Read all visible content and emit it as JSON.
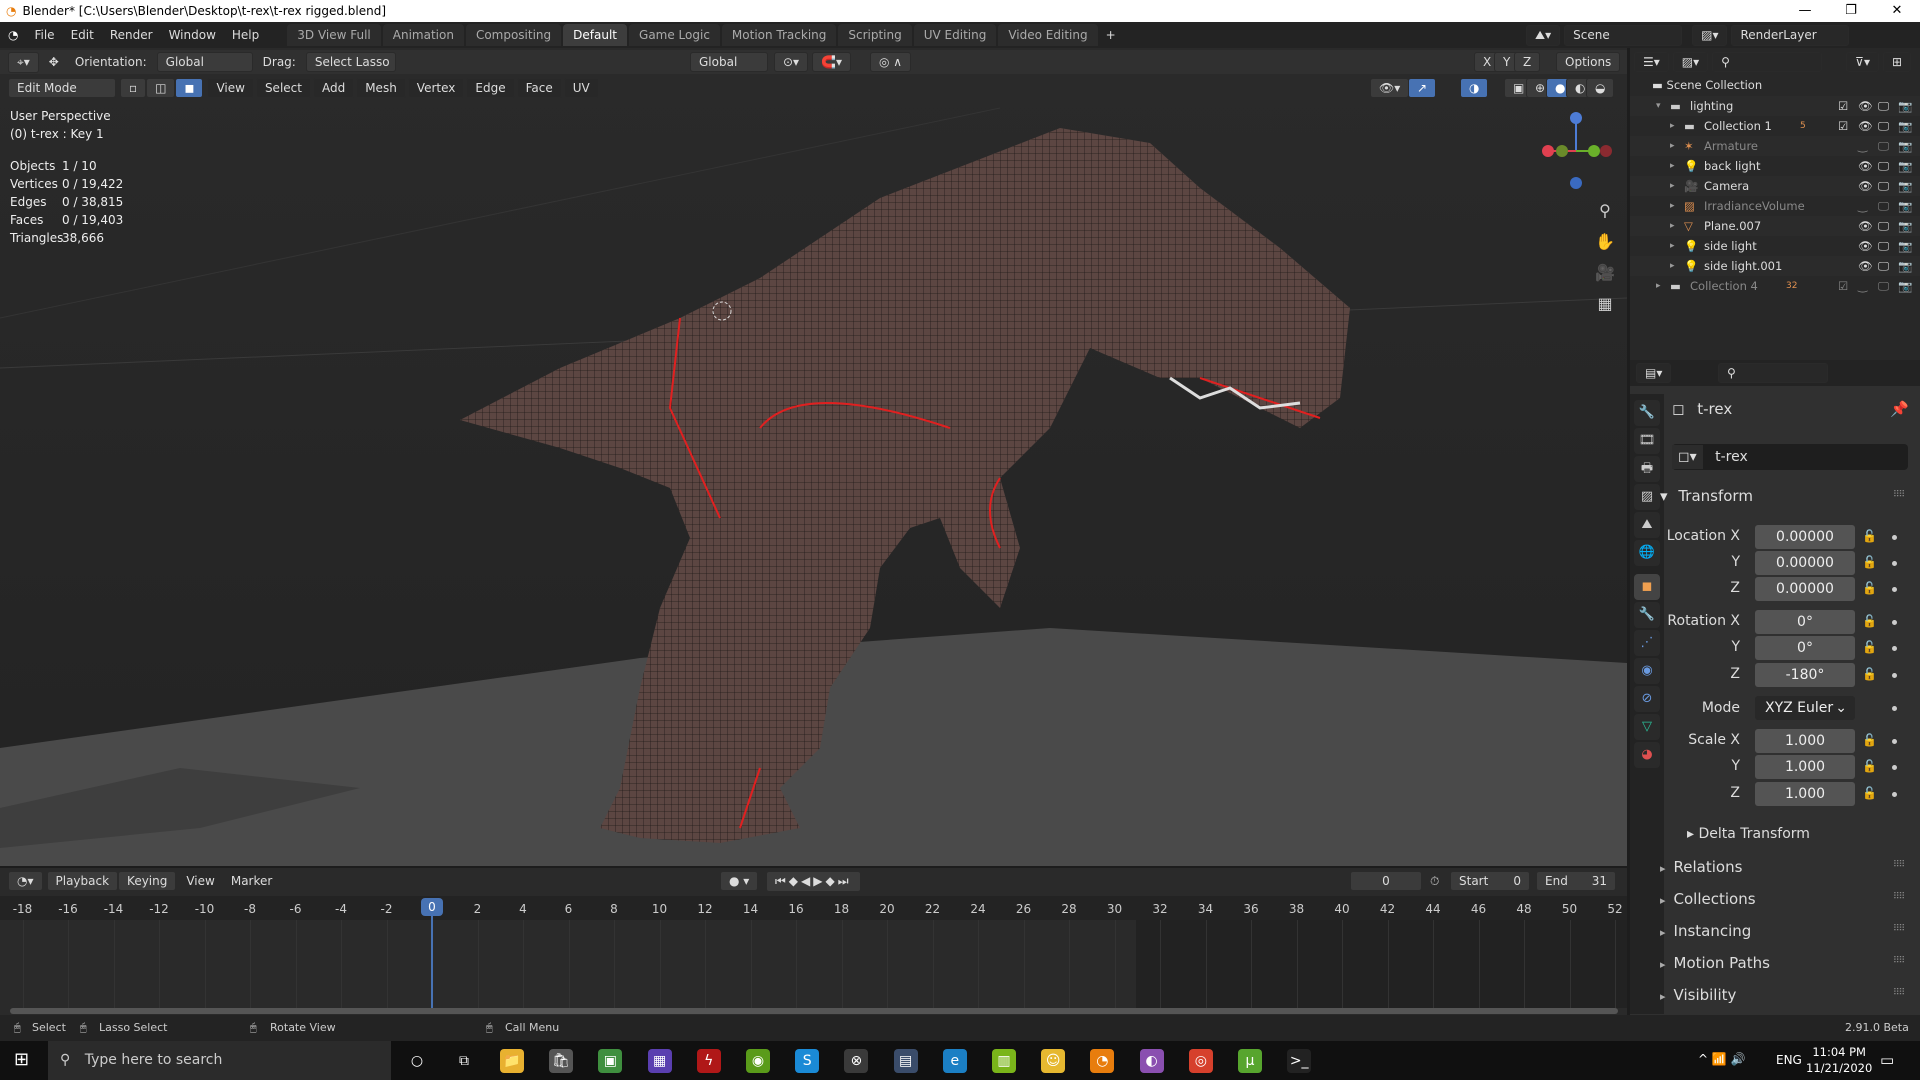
{
  "window": {
    "title": "Blender* [C:\\Users\\Blender\\Desktop\\t-rex\\t-rex rigged.blend]",
    "minimize": "—",
    "maximize": "❐",
    "close": "✕"
  },
  "menu": [
    "File",
    "Edit",
    "Render",
    "Window",
    "Help"
  ],
  "workspaces": [
    {
      "label": "3D View Full",
      "active": false
    },
    {
      "label": "Animation",
      "active": false
    },
    {
      "label": "Compositing",
      "active": false
    },
    {
      "label": "Default",
      "active": true
    },
    {
      "label": "Game Logic",
      "active": false
    },
    {
      "label": "Motion Tracking",
      "active": false
    },
    {
      "label": "Scripting",
      "active": false
    },
    {
      "label": "UV Editing",
      "active": false
    },
    {
      "label": "Video Editing",
      "active": false
    }
  ],
  "add_workspace": "+",
  "scene": {
    "name": "Scene",
    "view_layer": "RenderLayer"
  },
  "tool_header": {
    "orientation_label": "Orientation:",
    "orientation_value": "Global",
    "drag_label": "Drag:",
    "drag_value": "Select Lasso",
    "transform_orientation": "Global",
    "axis": [
      "X",
      "Y",
      "Z"
    ],
    "options": "Options"
  },
  "view_header": {
    "mode": "Edit Mode",
    "menus": [
      "View",
      "Select",
      "Add",
      "Mesh",
      "Vertex",
      "Edge",
      "Face",
      "UV"
    ]
  },
  "overlay_info": {
    "view": "User Perspective",
    "object": "(0) t-rex : Key 1",
    "stats": [
      {
        "label": "Objects",
        "value": "1 / 10"
      },
      {
        "label": "Vertices",
        "value": "0 / 19,422"
      },
      {
        "label": "Edges",
        "value": "0 / 38,815"
      },
      {
        "label": "Faces",
        "value": "0 / 19,403"
      },
      {
        "label": "Triangles",
        "value": "38,666"
      }
    ]
  },
  "outliner": {
    "root": "Scene Collection",
    "items": [
      {
        "label": "lighting",
        "depth": 0,
        "icon": "collection-icon",
        "color": "#ddd"
      },
      {
        "label": "Collection 1",
        "depth": 1,
        "icon": "collection-icon",
        "badge": "5",
        "color": "#ddd"
      },
      {
        "label": "Armature",
        "depth": 1,
        "icon": "armature-icon",
        "color": "#888"
      },
      {
        "label": "back light",
        "depth": 1,
        "icon": "light-icon",
        "color": "#ddd"
      },
      {
        "label": "Camera",
        "depth": 1,
        "icon": "camera-icon",
        "color": "#ddd"
      },
      {
        "label": "IrradianceVolume",
        "depth": 1,
        "icon": "lightprobe-icon",
        "color": "#888"
      },
      {
        "label": "Plane.007",
        "depth": 1,
        "icon": "mesh-icon",
        "color": "#ddd"
      },
      {
        "label": "side light",
        "depth": 1,
        "icon": "light-icon",
        "color": "#ddd"
      },
      {
        "label": "side light.001",
        "depth": 1,
        "icon": "light-icon",
        "color": "#ddd"
      },
      {
        "label": "Collection 4",
        "depth": 0,
        "icon": "collection-icon",
        "badge": "32",
        "color": "#888"
      }
    ]
  },
  "properties": {
    "object_name": "t-rex",
    "datablock": "t-rex",
    "transform_title": "Transform",
    "location": {
      "label": "Location X",
      "x": "0.00000",
      "y": "0.00000",
      "z": "0.00000"
    },
    "rotation": {
      "label": "Rotation X",
      "x": "0°",
      "y": "0°",
      "z": "-180°"
    },
    "mode": {
      "label": "Mode",
      "value": "XYZ Euler"
    },
    "scale": {
      "label": "Scale X",
      "x": "1.000",
      "y": "1.000",
      "z": "1.000"
    },
    "axis_labels": {
      "y": "Y",
      "z": "Z"
    },
    "subpanel": "Delta Transform",
    "sections": [
      "Relations",
      "Collections",
      "Instancing",
      "Motion Paths",
      "Visibility"
    ]
  },
  "timeline": {
    "menus": [
      "Playback",
      "Keying",
      "View",
      "Marker"
    ],
    "current_frame": "0",
    "start_label": "Start",
    "start": "0",
    "end_label": "End",
    "end": "31",
    "ticks": [
      -18,
      -16,
      -14,
      -12,
      -10,
      -8,
      -6,
      -4,
      -2,
      0,
      2,
      4,
      6,
      8,
      10,
      12,
      14,
      16,
      18,
      20,
      22,
      24,
      26,
      28,
      30,
      32,
      34,
      36,
      38,
      40,
      42,
      44,
      46,
      48,
      50,
      52
    ],
    "playhead": "0"
  },
  "statusbar": {
    "hints": [
      "Select",
      "Lasso Select",
      "Rotate View",
      "Call Menu"
    ],
    "version": "2.91.0 Beta"
  },
  "taskbar": {
    "search_placeholder": "Type here to search",
    "time": "11:04 PM",
    "date": "11/21/2020",
    "lang": "ENG",
    "apps": [
      {
        "name": "cortana",
        "glyph": "○",
        "color": "transparent"
      },
      {
        "name": "task-view",
        "glyph": "⧉",
        "color": "transparent"
      },
      {
        "name": "file-explorer",
        "glyph": "📁",
        "color": "#e8b130"
      },
      {
        "name": "store",
        "glyph": "🛍",
        "color": "#555"
      },
      {
        "name": "app-green",
        "glyph": "▣",
        "color": "#3f8f3f"
      },
      {
        "name": "app-purple",
        "glyph": "▦",
        "color": "#5a3fb0"
      },
      {
        "name": "app-red",
        "glyph": "ϟ",
        "color": "#b01818"
      },
      {
        "name": "nvidia",
        "glyph": "◉",
        "color": "#5a9b1a"
      },
      {
        "name": "skype",
        "glyph": "S",
        "color": "#1a8ad6"
      },
      {
        "name": "xbox",
        "glyph": "⊗",
        "color": "#3a3a3a"
      },
      {
        "name": "calculator",
        "glyph": "▤",
        "color": "#3a4c6a"
      },
      {
        "name": "edge",
        "glyph": "e",
        "color": "#1b7fc4"
      },
      {
        "name": "app-lime",
        "glyph": "▥",
        "color": "#7ab51a"
      },
      {
        "name": "app-yellow",
        "glyph": "☺",
        "color": "#e6b830"
      },
      {
        "name": "blender",
        "glyph": "◔",
        "color": "#e87d0d"
      },
      {
        "name": "app-gradient",
        "glyph": "◐",
        "color": "#8a4fb0"
      },
      {
        "name": "chrome",
        "glyph": "◎",
        "color": "#d6402c"
      },
      {
        "name": "utorrent",
        "glyph": "µ",
        "color": "#57a52e"
      },
      {
        "name": "terminal",
        "glyph": ">_",
        "color": "#222"
      }
    ]
  },
  "colors": {
    "accent": "#4772b3",
    "selected_edge": "#e02020",
    "object_orange": "#f0a050"
  }
}
